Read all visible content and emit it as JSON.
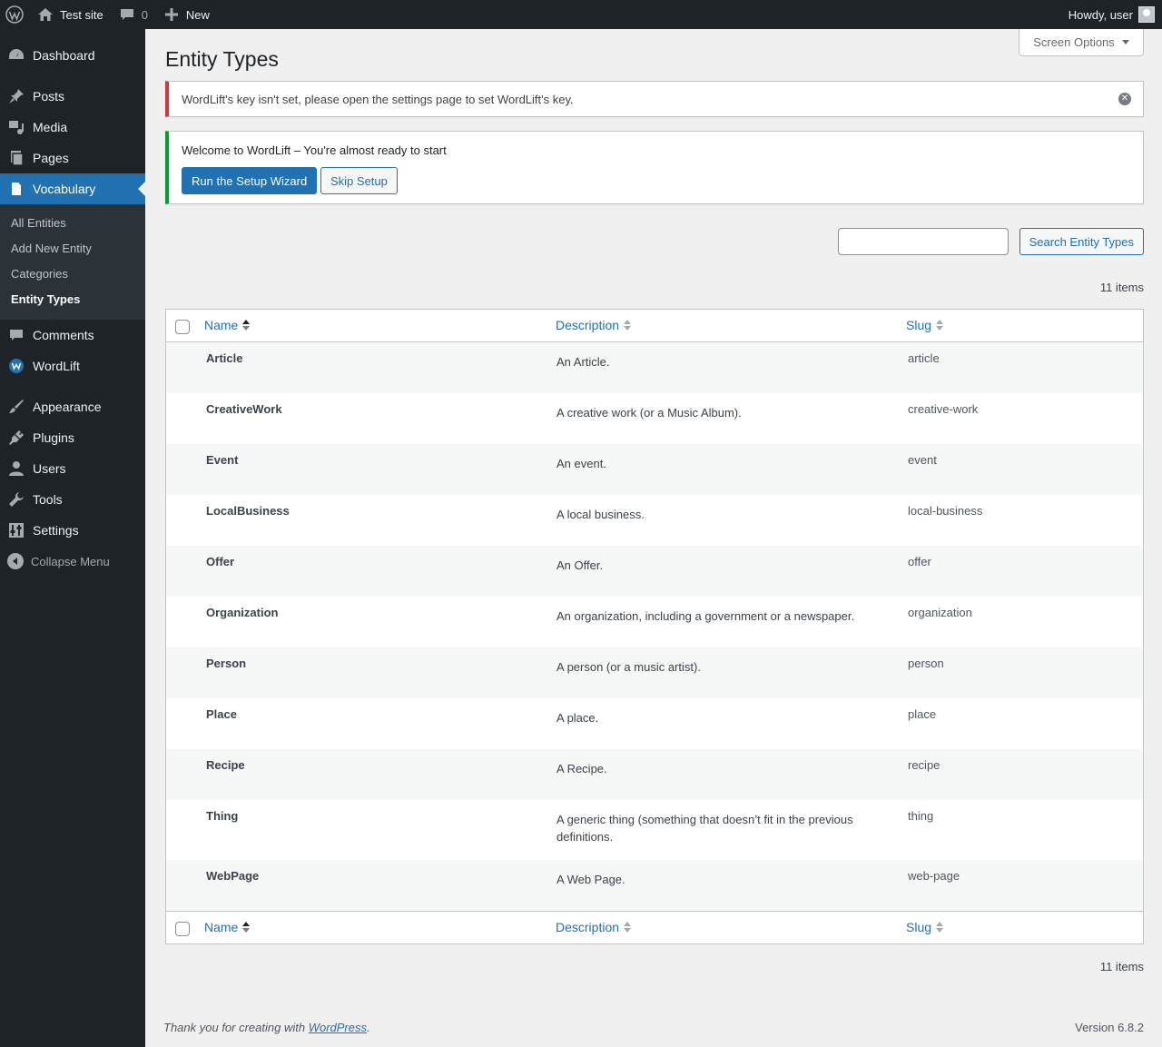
{
  "adminbar": {
    "site_name": "Test site",
    "comments_count": "0",
    "new_label": "New",
    "howdy": "Howdy, user"
  },
  "sidebar": {
    "items": [
      {
        "label": "Dashboard",
        "icon": "dashboard-icon"
      },
      {
        "label": "Posts",
        "icon": "pin-icon"
      },
      {
        "label": "Media",
        "icon": "media-icon"
      },
      {
        "label": "Pages",
        "icon": "pages-icon"
      },
      {
        "label": "Vocabulary",
        "icon": "document-icon"
      },
      {
        "label": "Comments",
        "icon": "comment-icon"
      },
      {
        "label": "WordLift",
        "icon": "wordlift-icon"
      },
      {
        "label": "Appearance",
        "icon": "brush-icon"
      },
      {
        "label": "Plugins",
        "icon": "plug-icon"
      },
      {
        "label": "Users",
        "icon": "user-icon"
      },
      {
        "label": "Tools",
        "icon": "wrench-icon"
      },
      {
        "label": "Settings",
        "icon": "sliders-icon"
      }
    ],
    "submenu": [
      "All Entities",
      "Add New Entity",
      "Categories",
      "Entity Types"
    ],
    "collapse_label": "Collapse Menu"
  },
  "screen_options": "Screen Options",
  "page_title": "Entity Types",
  "notices": {
    "error": "WordLift's key isn't set, please open the settings page to set WordLift's key.",
    "welcome": "Welcome to WordLift – You're almost ready to start",
    "run_wizard": "Run the Setup Wizard",
    "skip_setup": "Skip Setup"
  },
  "search": {
    "value": "",
    "button": "Search Entity Types"
  },
  "items_count": "11 items",
  "table": {
    "columns": [
      "Name",
      "Description",
      "Slug"
    ],
    "rows": [
      {
        "name": "Article",
        "description": "An Article.",
        "slug": "article"
      },
      {
        "name": "CreativeWork",
        "description": "A creative work (or a Music Album).",
        "slug": "creative-work"
      },
      {
        "name": "Event",
        "description": "An event.",
        "slug": "event"
      },
      {
        "name": "LocalBusiness",
        "description": "A local business.",
        "slug": "local-business"
      },
      {
        "name": "Offer",
        "description": "An Offer.",
        "slug": "offer"
      },
      {
        "name": "Organization",
        "description": "An organization, including a government or a newspaper.",
        "slug": "organization"
      },
      {
        "name": "Person",
        "description": "A person (or a music artist).",
        "slug": "person"
      },
      {
        "name": "Place",
        "description": "A place.",
        "slug": "place"
      },
      {
        "name": "Recipe",
        "description": "A Recipe.",
        "slug": "recipe"
      },
      {
        "name": "Thing",
        "description": "A generic thing (something that doesn’t fit in the previous definitions.",
        "slug": "thing"
      },
      {
        "name": "WebPage",
        "description": "A Web Page.",
        "slug": "web-page"
      }
    ]
  },
  "footer": {
    "thanks_prefix": "Thank you for creating with ",
    "thanks_link": "WordPress",
    "thanks_suffix": ".",
    "version": "Version 6.8.2"
  },
  "colors": {
    "admin_dark": "#1d2327",
    "accent": "#2271b1",
    "error": "#d63638",
    "success": "#00a32a"
  }
}
